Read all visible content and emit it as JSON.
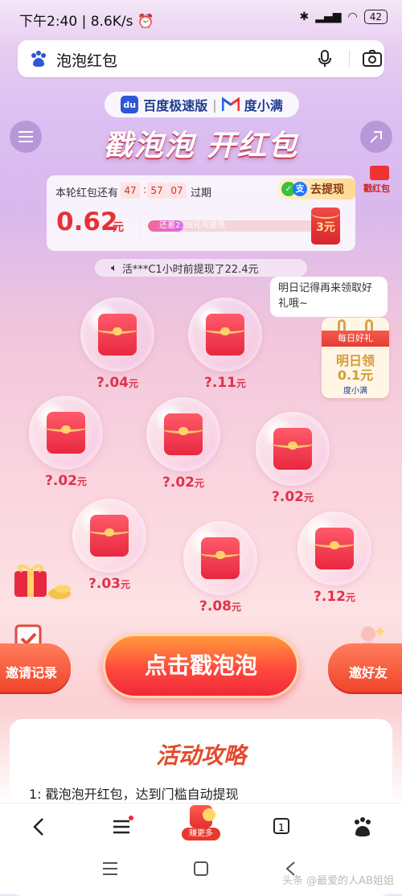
{
  "status": {
    "time": "下午2:40",
    "speed": "8.6K/s",
    "battery": "42"
  },
  "search": {
    "query": "泡泡红包"
  },
  "brand": {
    "name1": "百度极速版",
    "name2": "度小满"
  },
  "title": "戳泡泡 开红包",
  "card": {
    "prefix": "本轮红包还有",
    "hours": "47",
    "minutes": "57",
    "seconds": "07",
    "suffix": "过期",
    "amount": "0.62",
    "unit": "元",
    "progress_text": "还差2.38元可提现",
    "progress": 0.21,
    "target_envelope": "3元",
    "withdraw_label": "去提现"
  },
  "side_redpack_label": "戳红包",
  "ticker": "活***C1小时前提现了22.4元",
  "tomorrow_tip": "明日记得再来领取好礼哦~",
  "calendar": {
    "header": "每日好礼",
    "line1": "明日领",
    "line2": "0.1元",
    "footer": "度小满"
  },
  "bubbles": [
    {
      "label": "?.04",
      "unit": "元"
    },
    {
      "label": "?.11",
      "unit": "元"
    },
    {
      "label": "?.02",
      "unit": "元"
    },
    {
      "label": "?.02",
      "unit": "元"
    },
    {
      "label": "?.02",
      "unit": "元"
    },
    {
      "label": "?.03",
      "unit": "元"
    },
    {
      "label": "?.08",
      "unit": "元"
    },
    {
      "label": "?.12",
      "unit": "元"
    }
  ],
  "buttons": {
    "invite": "邀请记录",
    "main": "点击戳泡泡",
    "friend": "邀好友"
  },
  "panel": {
    "heading": "活动攻略",
    "rule1": "1: 戳泡泡开红包，达到门槛自动提现"
  },
  "nav": {
    "more_label": "赚更多",
    "tab_count": "1"
  },
  "watermark": "头条 @最爱的人AB姐姐",
  "colors": {
    "accent": "#e53238",
    "button": "#ff4a3c"
  }
}
